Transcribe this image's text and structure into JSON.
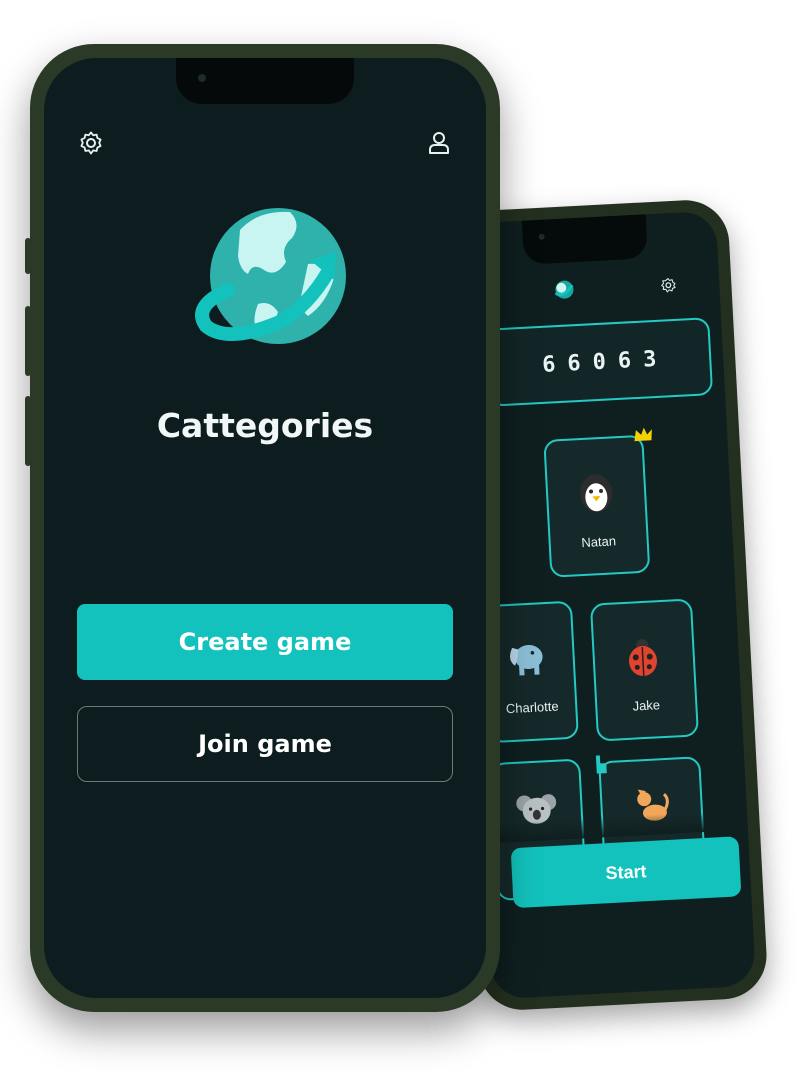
{
  "back_screen": {
    "room_code_digits": [
      "6",
      "6",
      "0",
      "6",
      "3"
    ],
    "players": [
      {
        "name": "Natan",
        "avatar_icon": "penguin-icon",
        "is_host": true
      },
      {
        "name": "Charlotte",
        "avatar_icon": "elephant-icon"
      },
      {
        "name": "Jake",
        "avatar_icon": "ladybug-icon"
      },
      {
        "name": "",
        "avatar_icon": "koala-icon"
      },
      {
        "name": "",
        "avatar_icon": "cat-icon"
      }
    ],
    "start_label": "Start",
    "top_icons": [
      "exit-icon",
      "globe-logo-icon",
      "gear-icon"
    ]
  },
  "front_screen": {
    "settings_icon": "gear-icon",
    "profile_icon": "user-icon",
    "logo_icon": "globe-arrow-logo",
    "app_title": "Cattegories",
    "create_label": "Create game",
    "join_label": "Join game"
  },
  "colors": {
    "accent": "#13c2bd",
    "screen_bg": "#0d1d1f",
    "frame": "#2b3a26",
    "text": "#ffffff"
  }
}
